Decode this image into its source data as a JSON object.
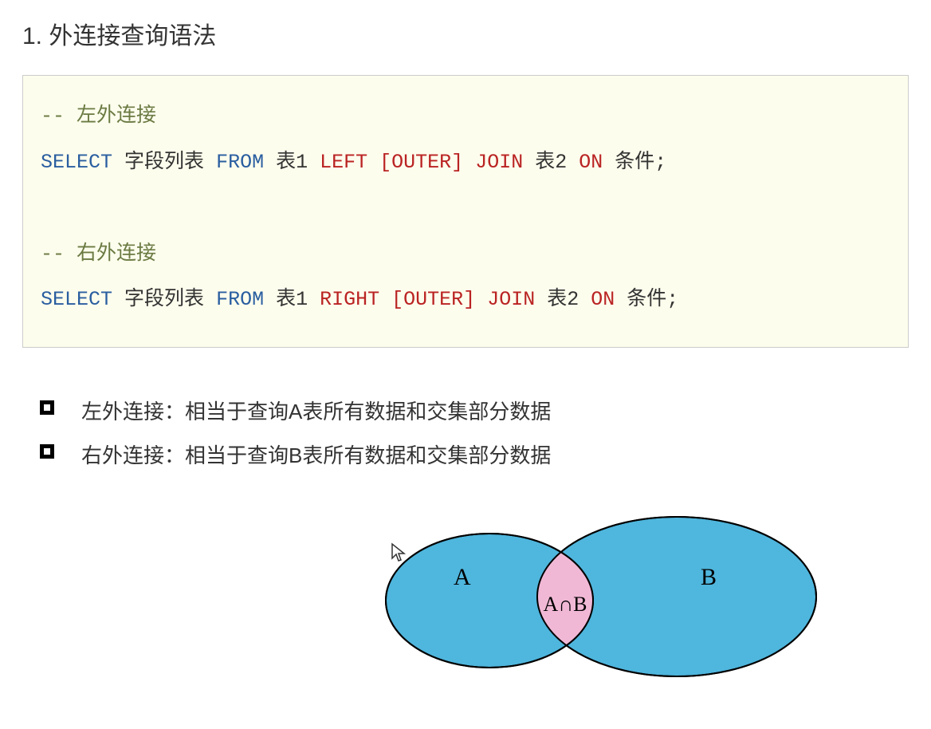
{
  "heading": "1. 外连接查询语法",
  "code": {
    "comment1": "-- 左外连接",
    "line1": {
      "select": "SELECT",
      "fields": "字段列表",
      "from": "FROM",
      "t1": "表1",
      "left": "LEFT",
      "outer": "[OUTER]",
      "join": "JOIN",
      "t2": "表2",
      "on": "ON",
      "cond": "条件;"
    },
    "comment2": "-- 右外连接",
    "line2": {
      "select": "SELECT",
      "fields": "字段列表",
      "from": "FROM",
      "t1": "表1",
      "right": "RIGHT",
      "outer": "[OUTER]",
      "join": "JOIN",
      "t2": "表2",
      "on": "ON",
      "cond": "条件;"
    }
  },
  "bullets": [
    "左外连接：相当于查询A表所有数据和交集部分数据",
    "右外连接：相当于查询B表所有数据和交集部分数据"
  ],
  "venn": {
    "labelA": "A",
    "labelB": "B",
    "labelIntersect": "A∩B"
  }
}
